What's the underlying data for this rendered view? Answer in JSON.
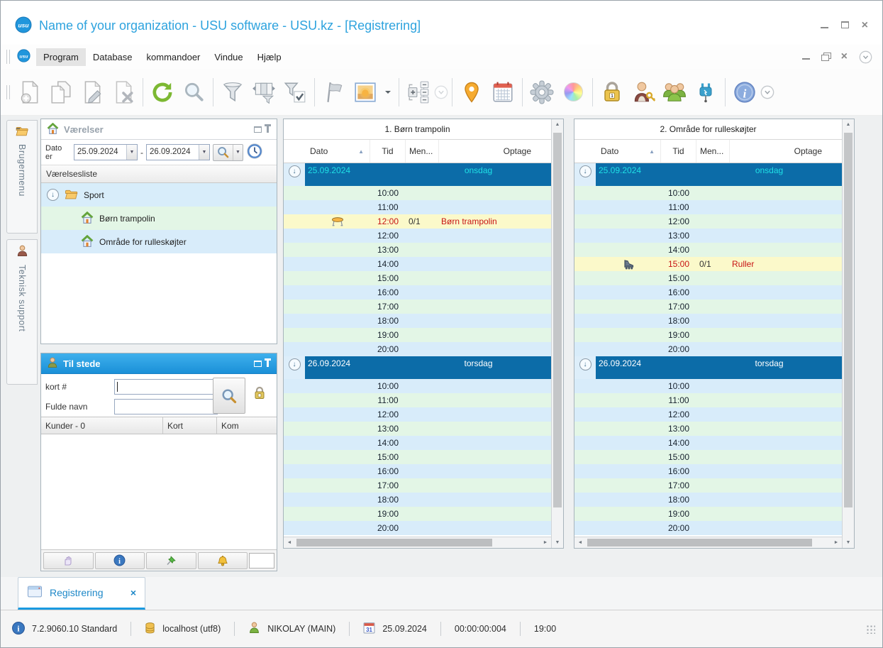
{
  "window": {
    "title": "Name of your organization - USU software - USU.kz - [Registrering]",
    "logo_text": "usu"
  },
  "menu": {
    "items": [
      "Program",
      "Database",
      "kommandoer",
      "Vindue",
      "Hjælp"
    ],
    "active_item": "Program"
  },
  "toolbar": {
    "buttons": [
      "new-document",
      "copy-document",
      "edit-document",
      "delete-document",
      "refresh",
      "search",
      "filter",
      "filter-columns",
      "filter-apply",
      "flag",
      "image",
      "scale-windows",
      "overflow-disabled",
      "map-pin",
      "calendar",
      "settings",
      "colors",
      "lock",
      "user-permissions",
      "users",
      "plugin",
      "info",
      "overflow"
    ]
  },
  "side_tabs": {
    "items": [
      {
        "label": "Brugermenu"
      },
      {
        "label": "Teknisk support"
      }
    ]
  },
  "rooms_panel": {
    "title": "Værelser",
    "date_label": "Dato er",
    "date_from": "25.09.2024",
    "date_to": "26.09.2024",
    "date_separator": "-",
    "list_header": "Værelsesliste",
    "tree": {
      "root": "Sport",
      "children": [
        "Børn trampolin",
        "Område for rulleskøjter"
      ]
    }
  },
  "present_panel": {
    "title": "Til stede",
    "card_label": "kort #",
    "card_value": "",
    "name_label": "Fulde navn",
    "name_value": "",
    "columns": [
      "Kunder - 0",
      "Kort",
      "Kom"
    ]
  },
  "schedules": [
    {
      "title": "1. Børn trampolin",
      "columns": {
        "dato": "Dato",
        "tid": "Tid",
        "men": "Men...",
        "optage": "Optage"
      },
      "rows": [
        {
          "group": true,
          "accent": true,
          "cls": "group accent",
          "date": "25.09.2024",
          "day": "onsdag"
        },
        {
          "slot": true,
          "cls": "t green",
          "time": "10:00"
        },
        {
          "slot": true,
          "cls": "t blue",
          "time": "11:00"
        },
        {
          "slot": true,
          "cls": "booked",
          "time": "12:00",
          "men": "0/1",
          "label": "Børn trampolin",
          "icon": "trampoline-icon",
          "tramp": true
        },
        {
          "slot": true,
          "cls": "t blue",
          "time": "12:00"
        },
        {
          "slot": true,
          "cls": "t green",
          "time": "13:00"
        },
        {
          "slot": true,
          "cls": "t blue",
          "time": "14:00"
        },
        {
          "slot": true,
          "cls": "t green",
          "time": "15:00"
        },
        {
          "slot": true,
          "cls": "t blue",
          "time": "16:00"
        },
        {
          "slot": true,
          "cls": "t green",
          "time": "17:00"
        },
        {
          "slot": true,
          "cls": "t blue",
          "time": "18:00"
        },
        {
          "slot": true,
          "cls": "t green",
          "time": "19:00"
        },
        {
          "slot": true,
          "cls": "t blue",
          "time": "20:00"
        },
        {
          "group": true,
          "cls": "group",
          "date": "26.09.2024",
          "day": "torsdag"
        },
        {
          "slot": true,
          "cls": "t blue",
          "time": "10:00"
        },
        {
          "slot": true,
          "cls": "t green",
          "time": "11:00"
        },
        {
          "slot": true,
          "cls": "t blue",
          "time": "12:00"
        },
        {
          "slot": true,
          "cls": "t green",
          "time": "13:00"
        },
        {
          "slot": true,
          "cls": "t blue",
          "time": "14:00"
        },
        {
          "slot": true,
          "cls": "t green",
          "time": "15:00"
        },
        {
          "slot": true,
          "cls": "t blue",
          "time": "16:00"
        },
        {
          "slot": true,
          "cls": "t green",
          "time": "17:00"
        },
        {
          "slot": true,
          "cls": "t blue",
          "time": "18:00"
        },
        {
          "slot": true,
          "cls": "t green",
          "time": "19:00"
        },
        {
          "slot": true,
          "cls": "t blue",
          "time": "20:00"
        }
      ]
    },
    {
      "title": "2. Område for rulleskøjter",
      "columns": {
        "dato": "Dato",
        "tid": "Tid",
        "men": "Men...",
        "optage": "Optage"
      },
      "rows": [
        {
          "group": true,
          "accent": true,
          "cls": "group accent",
          "date": "25.09.2024",
          "day": "onsdag"
        },
        {
          "slot": true,
          "cls": "t green",
          "time": "10:00"
        },
        {
          "slot": true,
          "cls": "t blue",
          "time": "11:00"
        },
        {
          "slot": true,
          "cls": "t green",
          "time": "12:00"
        },
        {
          "slot": true,
          "cls": "t blue",
          "time": "13:00"
        },
        {
          "slot": true,
          "cls": "t green",
          "time": "14:00"
        },
        {
          "slot": true,
          "cls": "booked",
          "time": "15:00",
          "men": "0/1",
          "label": "Ruller",
          "icon": "rollerskate-icon",
          "skate": true
        },
        {
          "slot": true,
          "cls": "t green",
          "time": "15:00"
        },
        {
          "slot": true,
          "cls": "t blue",
          "time": "16:00"
        },
        {
          "slot": true,
          "cls": "t green",
          "time": "17:00"
        },
        {
          "slot": true,
          "cls": "t blue",
          "time": "18:00"
        },
        {
          "slot": true,
          "cls": "t green",
          "time": "19:00"
        },
        {
          "slot": true,
          "cls": "t blue",
          "time": "20:00"
        },
        {
          "group": true,
          "cls": "group",
          "date": "26.09.2024",
          "day": "torsdag"
        },
        {
          "slot": true,
          "cls": "t blue",
          "time": "10:00"
        },
        {
          "slot": true,
          "cls": "t green",
          "time": "11:00"
        },
        {
          "slot": true,
          "cls": "t blue",
          "time": "12:00"
        },
        {
          "slot": true,
          "cls": "t green",
          "time": "13:00"
        },
        {
          "slot": true,
          "cls": "t blue",
          "time": "14:00"
        },
        {
          "slot": true,
          "cls": "t green",
          "time": "15:00"
        },
        {
          "slot": true,
          "cls": "t blue",
          "time": "16:00"
        },
        {
          "slot": true,
          "cls": "t green",
          "time": "17:00"
        },
        {
          "slot": true,
          "cls": "t blue",
          "time": "18:00"
        },
        {
          "slot": true,
          "cls": "t green",
          "time": "19:00"
        },
        {
          "slot": true,
          "cls": "t blue",
          "time": "20:00"
        }
      ]
    }
  ],
  "doc_tabs": {
    "active": "Registrering",
    "close_glyph": "×"
  },
  "status_bar": {
    "version": "7.2.9060.10 Standard",
    "database": "localhost (utf8)",
    "user": "NIKOLAY (MAIN)",
    "calendar_day": "31",
    "date": "25.09.2024",
    "counter": "00:00:00:004",
    "time": "19:00"
  }
}
